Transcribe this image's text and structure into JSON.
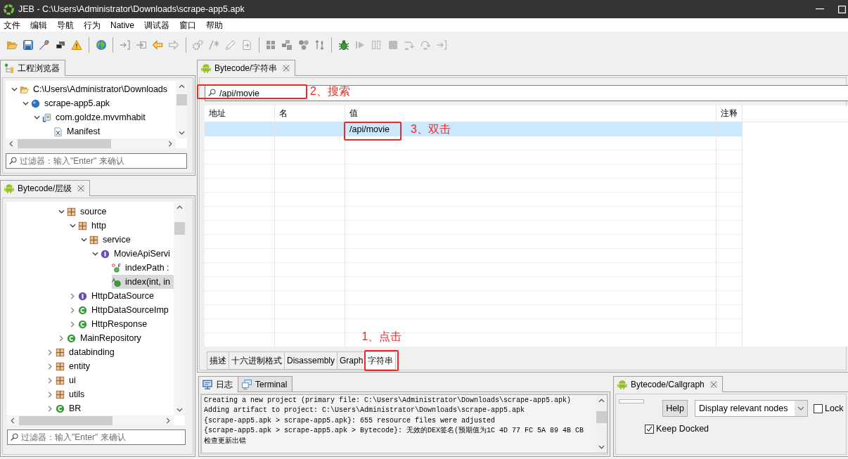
{
  "window": {
    "title": "JEB - C:\\Users\\Administrator\\Downloads\\scrape-app5.apk"
  },
  "menu": [
    "文件",
    "编辑",
    "导航",
    "行为",
    "Native",
    "调试器",
    "窗口",
    "帮助"
  ],
  "toolbar": [
    [
      {
        "disabled": false
      },
      {
        "disabled": false
      },
      {
        "disabled": false
      },
      {
        "disabled": false
      },
      {
        "disabled": false
      }
    ],
    [
      {
        "disabled": false
      }
    ],
    [
      {
        "disabled": true
      },
      {
        "disabled": true
      },
      {
        "disabled": false
      },
      {
        "disabled": true
      }
    ],
    [
      {
        "disabled": true
      },
      {
        "disabled": true
      },
      {
        "disabled": true
      },
      {
        "disabled": true
      }
    ],
    [
      {
        "disabled": false
      },
      {
        "disabled": false
      },
      {
        "disabled": false
      },
      {
        "disabled": false
      }
    ],
    [
      {
        "disabled": false
      },
      {
        "disabled": true
      },
      {
        "disabled": true
      },
      {
        "disabled": true
      },
      {
        "disabled": true
      },
      {
        "disabled": true
      },
      {
        "disabled": true
      }
    ]
  ],
  "project_browser": {
    "tab": {
      "label": "工程浏览器",
      "selected": true
    },
    "tree": [
      {
        "label": "C:\\Users\\Administrator\\Downloads",
        "kind": "folder",
        "expanded": true,
        "selected": false,
        "children": [
          {
            "label": "scrape-app5.apk",
            "kind": "apk",
            "expanded": true,
            "selected": false,
            "children": [
              {
                "label": "com.goldze.mvvmhabit",
                "kind": "module",
                "expanded": true,
                "selected": false,
                "children": [
                  {
                    "label": "Manifest",
                    "kind": "manifest",
                    "selected": false
                  }
                ]
              }
            ]
          }
        ]
      }
    ],
    "filter": {
      "placeholder": "过滤器：输入\"Enter\" 来确认"
    }
  },
  "hierarchy": {
    "tab": {
      "label": "Bytecode/层级",
      "selected": true
    },
    "tree": [
      {
        "children": [
          {
            "label": "source",
            "kind": "package",
            "expanded": true,
            "selected": false,
            "children": [
              {
                "label": "http",
                "kind": "package",
                "expanded": true,
                "selected": false,
                "children": [
                  {
                    "label": "service",
                    "kind": "package",
                    "expanded": true,
                    "selected": false,
                    "children": [
                      {
                        "label": "MovieApiServi",
                        "kind": "interface",
                        "expanded": true,
                        "selected": false,
                        "children": [
                          {
                            "label": "indexPath :",
                            "kind": "field",
                            "selected": false
                          },
                          {
                            "label": "index(int, in",
                            "kind": "method",
                            "selected": true
                          }
                        ]
                      }
                    ]
                  }
                ]
              },
              {
                "label": "HttpDataSource",
                "kind": "interface",
                "expanded": false,
                "selected": false
              },
              {
                "label": "HttpDataSourceImp",
                "kind": "class",
                "expanded": false,
                "selected": false
              },
              {
                "label": "HttpResponse",
                "kind": "class",
                "expanded": false,
                "selected": false
              }
            ]
          },
          {
            "label": "MainRepository",
            "kind": "class",
            "expanded": false,
            "selected": false
          }
        ]
      },
      {
        "label": "databinding",
        "kind": "package",
        "expanded": false,
        "selected": false
      },
      {
        "label": "entity",
        "kind": "package",
        "expanded": false,
        "selected": false
      },
      {
        "label": "ui",
        "kind": "package",
        "expanded": false,
        "selected": false
      },
      {
        "label": "utils",
        "kind": "package",
        "expanded": false,
        "selected": false
      },
      {
        "label": "BR",
        "kind": "class",
        "expanded": false,
        "selected": false
      }
    ],
    "filter": {
      "placeholder": "过滤器：输入\"Enter\" 来确认"
    }
  },
  "strings_view": {
    "tab": {
      "label": "Bytecode/字符串",
      "selected": true
    },
    "search": {
      "value": "/api/movie",
      "annotation": "2、搜索"
    },
    "table": {
      "columns": [
        "地址",
        "名",
        "值",
        "注释"
      ],
      "rows": [
        {
          "value": "/api/movie",
          "selected": true,
          "annotation": "3、双击"
        }
      ]
    },
    "bottom_tabs": [
      {
        "label": "描述",
        "selected": false
      },
      {
        "label": "十六进制格式",
        "selected": false
      },
      {
        "label": "Disassembly",
        "selected": false
      },
      {
        "label": "Graph",
        "selected": false
      },
      {
        "label": "字符串",
        "selected": true,
        "annotation": "1、点击"
      }
    ]
  },
  "log": {
    "tabs": [
      {
        "label": "日志",
        "selected": true
      },
      {
        "label": "Terminal",
        "selected": false
      }
    ],
    "lines": [
      "Creating a new project (primary file: C:\\Users\\Administrator\\Downloads\\scrape-app5.apk)",
      "Adding artifact to project: C:\\Users\\Administrator\\Downloads\\scrape-app5.apk",
      "{scrape-app5.apk > scrape-app5.apk}: 655 resource files were adjusted",
      "{scrape-app5.apk > scrape-app5.apk > Bytecode}: 无效的DEX签名(预期值为1C 4D 77 FC 5A 89 4B CB",
      "检查更新出错"
    ]
  },
  "callgraph": {
    "tab": {
      "label": "Bytecode/Callgraph",
      "selected": true
    },
    "help_button": "Help",
    "display_select": {
      "value": "Display relevant nodes"
    },
    "lock": {
      "label": "Lock",
      "checked": false
    },
    "keep_docked": {
      "label": "Keep Docked",
      "checked": true
    }
  }
}
